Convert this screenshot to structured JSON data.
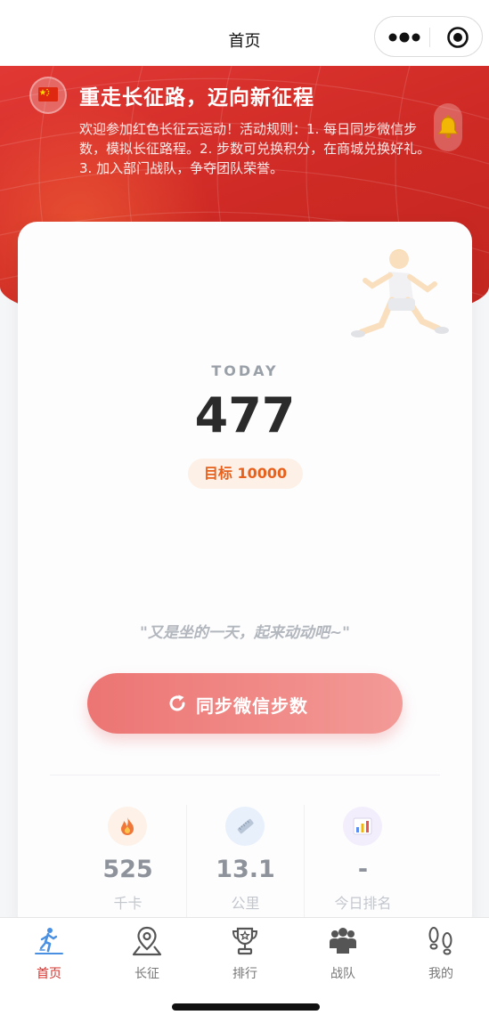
{
  "navbar": {
    "title": "首页",
    "capsule_icons": [
      "more-dots-icon",
      "close-target-icon"
    ]
  },
  "hero": {
    "title": "重走长征路，迈向新征程",
    "description": "欢迎参加红色长征云运动！活动规则：1. 每日同步微信步数，模拟长征路程。2. 步数可兑换积分，在商城兑换好礼。3. 加入部门战队，争夺团队荣誉。",
    "icons": [
      "china-flag-icon",
      "bell-icon"
    ]
  },
  "today": {
    "label": "TODAY",
    "steps": "477",
    "goal": "目标 10000",
    "motto": "\"又是坐的一天，起来动动吧~\"",
    "sync_button": "同步微信步数"
  },
  "stats": [
    {
      "icon": "fire-icon",
      "value": "525",
      "label": "千卡"
    },
    {
      "icon": "ruler-icon",
      "value": "13.1",
      "label": "公里"
    },
    {
      "icon": "bar-chart-icon",
      "value": "-",
      "label": "今日排名"
    }
  ],
  "tabs": [
    {
      "label": "首页",
      "icon": "runner-icon",
      "active": true
    },
    {
      "label": "长征",
      "icon": "map-pin-icon",
      "active": false
    },
    {
      "label": "排行",
      "icon": "trophy-icon",
      "active": false
    },
    {
      "label": "战队",
      "icon": "group-icon",
      "active": false
    },
    {
      "label": "我的",
      "icon": "footprints-icon",
      "active": false
    }
  ],
  "colors": {
    "brand_red": "#d9302b",
    "hero_red": "#cf2a25",
    "sync_button": "#ec7573",
    "goal_orange": "#e8611c"
  }
}
